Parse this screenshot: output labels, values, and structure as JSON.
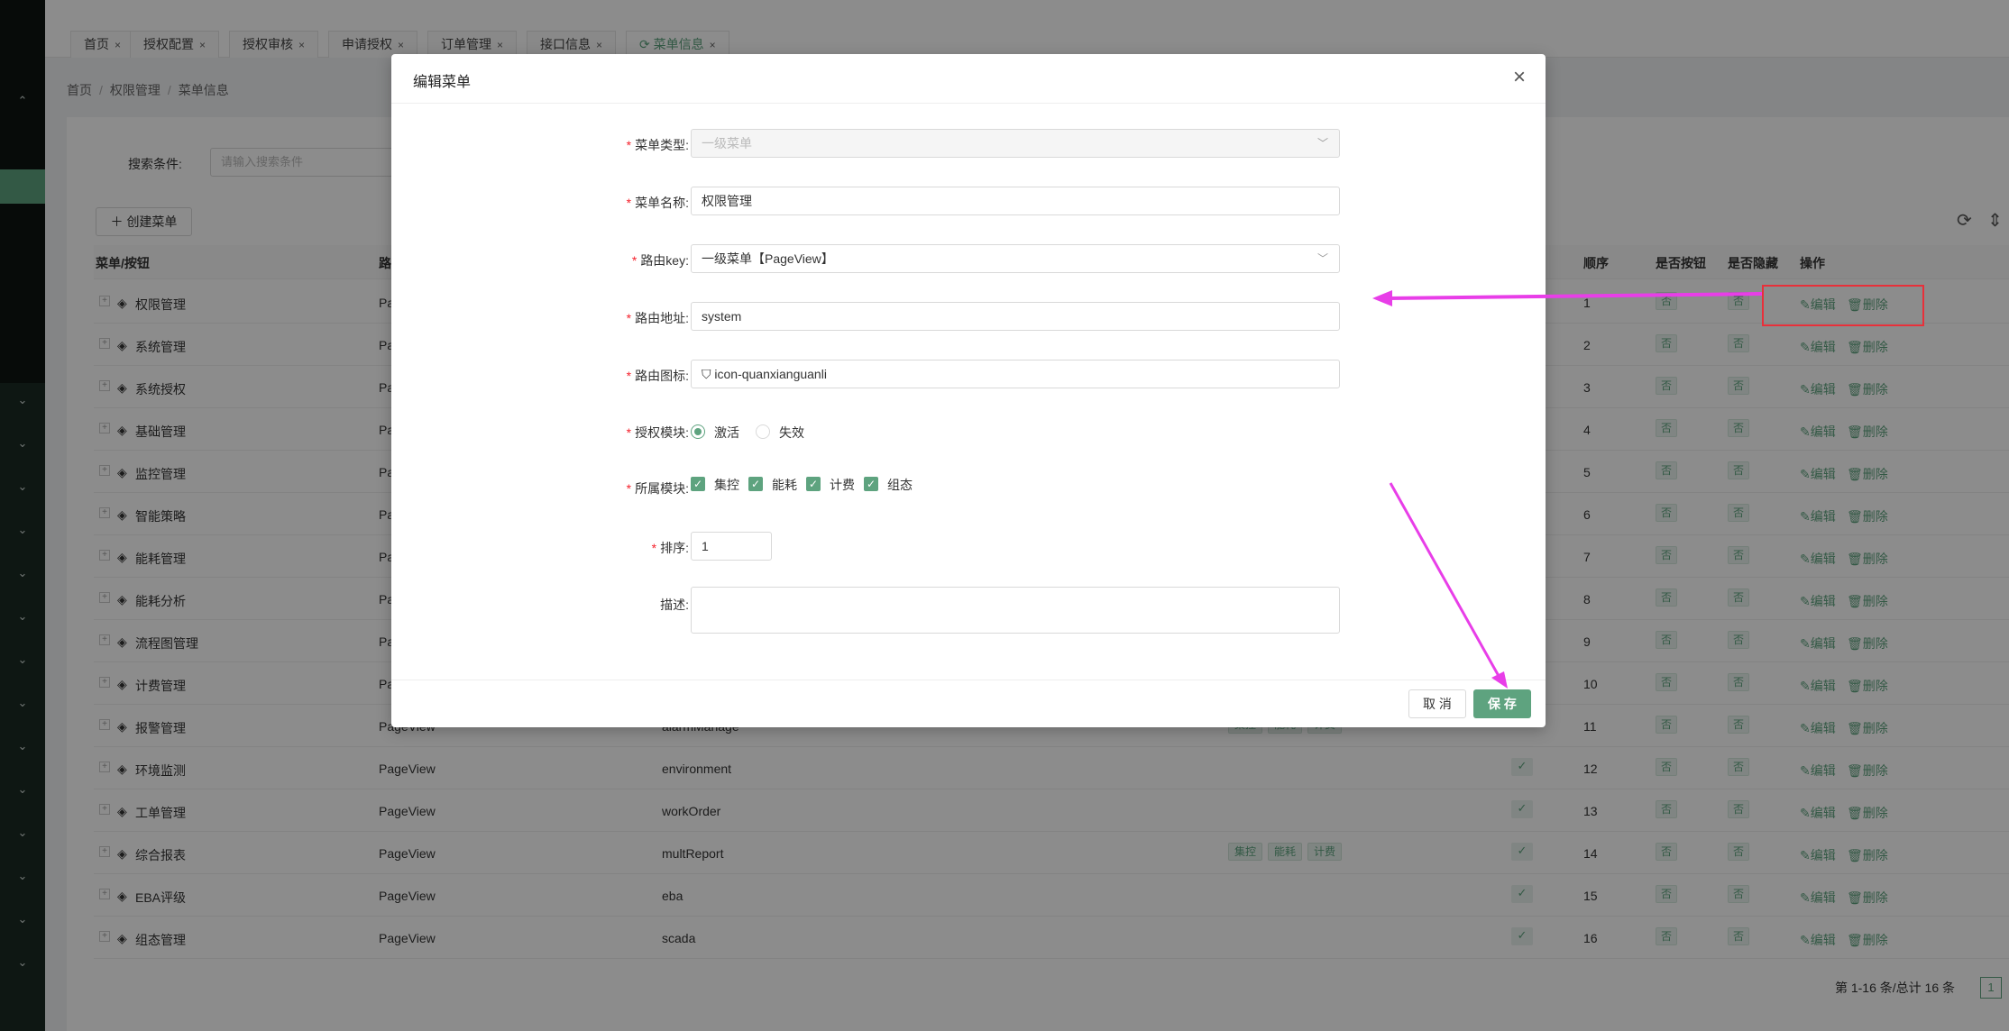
{
  "tabs": [
    {
      "label": "首页"
    },
    {
      "label": "授权配置"
    },
    {
      "label": "授权审核"
    },
    {
      "label": "申请授权"
    },
    {
      "label": "订单管理"
    },
    {
      "label": "接口信息"
    },
    {
      "label": "菜单信息"
    }
  ],
  "breadcrumb": [
    "首页",
    "权限管理",
    "菜单信息"
  ],
  "search": {
    "label": "搜索条件:",
    "placeholder": "请输入搜索条件"
  },
  "toolbar": {
    "create_label": "创建菜单"
  },
  "table": {
    "headers": {
      "menu": "菜单/按钮",
      "path_partial": "路",
      "order": "顺序",
      "is_button": "是否按钮",
      "is_hidden": "是否隐藏",
      "action": "操作"
    },
    "edit_label": "编辑",
    "delete_label": "删除",
    "no_label": "否",
    "rows": [
      {
        "name": "权限管理",
        "type": "Pa",
        "route": "",
        "modules": [],
        "checked": false,
        "order": "1"
      },
      {
        "name": "系统管理",
        "type": "Pa",
        "route": "",
        "modules": [],
        "checked": false,
        "order": "2"
      },
      {
        "name": "系统授权",
        "type": "Pa",
        "route": "",
        "modules": [],
        "checked": false,
        "order": "3"
      },
      {
        "name": "基础管理",
        "type": "Pa",
        "route": "",
        "modules": [],
        "checked": false,
        "order": "4"
      },
      {
        "name": "监控管理",
        "type": "Pa",
        "route": "",
        "modules": [],
        "checked": false,
        "order": "5"
      },
      {
        "name": "智能策略",
        "type": "Pa",
        "route": "",
        "modules": [],
        "checked": false,
        "order": "6"
      },
      {
        "name": "能耗管理",
        "type": "Pa",
        "route": "",
        "modules": [],
        "checked": false,
        "order": "7"
      },
      {
        "name": "能耗分析",
        "type": "Pa",
        "route": "",
        "modules": [],
        "checked": false,
        "order": "8"
      },
      {
        "name": "流程图管理",
        "type": "Pa",
        "route": "",
        "modules": [],
        "checked": false,
        "order": "9"
      },
      {
        "name": "计费管理",
        "type": "Pa",
        "route": "",
        "modules": [],
        "checked": false,
        "order": "10"
      },
      {
        "name": "报警管理",
        "type": "PageView",
        "route": "alarmManage",
        "modules": [
          "集控",
          "能耗",
          "计费"
        ],
        "checked": false,
        "order": "11"
      },
      {
        "name": "环境监测",
        "type": "PageView",
        "route": "environment",
        "modules": [],
        "checked": true,
        "order": "12"
      },
      {
        "name": "工单管理",
        "type": "PageView",
        "route": "workOrder",
        "modules": [],
        "checked": true,
        "order": "13"
      },
      {
        "name": "综合报表",
        "type": "PageView",
        "route": "multReport",
        "modules": [
          "集控",
          "能耗",
          "计费"
        ],
        "checked": true,
        "order": "14"
      },
      {
        "name": "EBA评级",
        "type": "PageView",
        "route": "eba",
        "modules": [],
        "checked": true,
        "order": "15"
      },
      {
        "name": "组态管理",
        "type": "PageView",
        "route": "scada",
        "modules": [],
        "checked": true,
        "order": "16"
      }
    ]
  },
  "pagination": {
    "summary": "第 1-16 条/总计 16 条",
    "page": "1"
  },
  "modal": {
    "title": "编辑菜单",
    "menu_type": {
      "label": "菜单类型:",
      "value": "一级菜单"
    },
    "menu_name": {
      "label": "菜单名称:",
      "value": "权限管理"
    },
    "route_key": {
      "label": "路由key:",
      "value": "一级菜单【PageView】"
    },
    "route_addr": {
      "label": "路由地址:",
      "value": "system"
    },
    "route_icon": {
      "label": "路由图标:",
      "value": "icon-quanxianguanli"
    },
    "auth_module": {
      "label": "授权模块:",
      "options": [
        "激活",
        "失效"
      ],
      "selected": "激活"
    },
    "belong_module": {
      "label": "所属模块:",
      "options": [
        "集控",
        "能耗",
        "计费",
        "组态"
      ]
    },
    "order": {
      "label": "排序:",
      "value": "1"
    },
    "desc": {
      "label": "描述:",
      "value": ""
    },
    "cancel_label": "取 消",
    "save_label": "保 存"
  },
  "colors": {
    "accent": "#5ea37f",
    "annotation": "#e83ee8",
    "highlight_box": "#e8303a"
  }
}
